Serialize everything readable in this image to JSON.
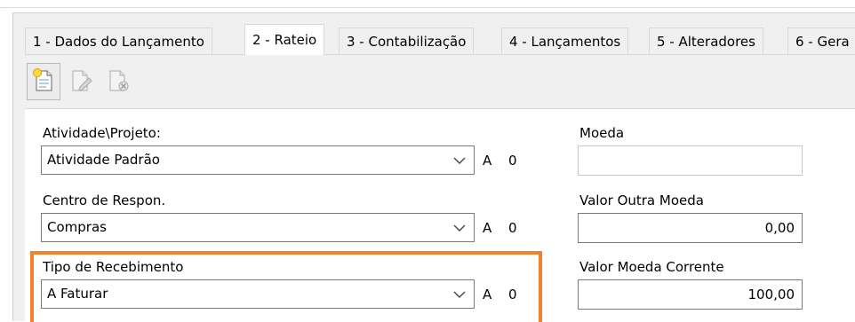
{
  "tabs": [
    {
      "label": "1 - Dados do Lançamento",
      "active": false
    },
    {
      "label": "2 - Rateio",
      "active": true
    },
    {
      "label": "3 - Contabilização",
      "active": false
    },
    {
      "label": "4 - Lançamentos",
      "active": false
    },
    {
      "label": "5 - Alteradores",
      "active": false
    },
    {
      "label": "6 - Gera",
      "active": false
    }
  ],
  "toolbar": {
    "icons": [
      "new-document-icon",
      "edit-document-icon",
      "delete-document-icon"
    ]
  },
  "form": {
    "atividade": {
      "label": "Atividade\\Projeto:",
      "value": "Atividade Padrão",
      "letter": "A",
      "zero": "0"
    },
    "centro": {
      "label": "Centro de Respon.",
      "value": "Compras",
      "letter": "A",
      "zero": "0"
    },
    "tipo": {
      "label": "Tipo de Recebimento",
      "value": "A Faturar",
      "letter": "A",
      "zero": "0"
    },
    "moeda": {
      "label": "Moeda",
      "value": ""
    },
    "valor_outra": {
      "label": "Valor Outra Moeda",
      "value": "0,00"
    },
    "valor_corrente": {
      "label": "Valor Moeda Corrente",
      "value": "100,00"
    }
  },
  "colors": {
    "highlight": "#f2822f"
  }
}
